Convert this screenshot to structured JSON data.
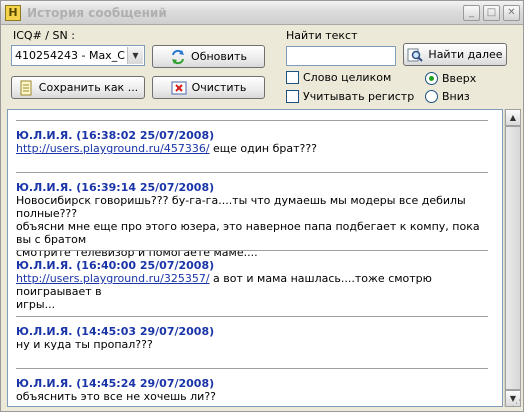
{
  "window": {
    "title": "История сообщений",
    "app_icon_letter": "H"
  },
  "left_panel": {
    "icq_label": "ICQ# / SN :",
    "contact_value": "410254243 - Max_Cher",
    "refresh_button": "Обновить",
    "save_button": "Сохранить как ...",
    "clear_button": "Очистить"
  },
  "search": {
    "label": "Найти текст",
    "value": "",
    "find_next_button": "Найти далее",
    "whole_word": {
      "label": "Слово целиком",
      "checked": false
    },
    "match_case": {
      "label": "Учитывать регистр",
      "checked": false
    },
    "direction_up": {
      "label": "Вверх",
      "selected": true
    },
    "direction_down": {
      "label": "Вниз",
      "selected": false
    }
  },
  "messages": [
    {
      "sender": "Ю.Л.И.Я. (16:38:02 25/07/2008)",
      "link": "http://users.playground.ru/457336/",
      "text_after_link": " еще один брат???",
      "text_lines": []
    },
    {
      "sender": "Ю.Л.И.Я. (16:39:14 25/07/2008)",
      "link": "",
      "text_after_link": "",
      "text_lines": [
        "Новосибирск говоришь??? бу-га-га....ты что думаешь мы модеры все дебилы полные???",
        "объясни мне еще про этого юзера, это наверное папа подбегает к компу, пока вы с братом",
        "смотрите телевизор и помогаете маме...."
      ]
    },
    {
      "sender": "Ю.Л.И.Я. (16:40:00 25/07/2008)",
      "link": "http://users.playground.ru/325357/",
      "text_after_link": " а вот и мама нашлась....тоже смотрю поиграывает в",
      "text_lines": [
        "игры..."
      ]
    },
    {
      "sender": "Ю.Л.И.Я. (14:45:03 29/07/2008)",
      "link": "",
      "text_after_link": "",
      "text_lines": [
        "ну и куда ты пропал???"
      ]
    },
    {
      "sender": "Ю.Л.И.Я. (14:45:24 29/07/2008)",
      "link": "",
      "text_after_link": "",
      "text_lines": [
        "объяснить это все не хочешь ли??"
      ]
    }
  ]
}
